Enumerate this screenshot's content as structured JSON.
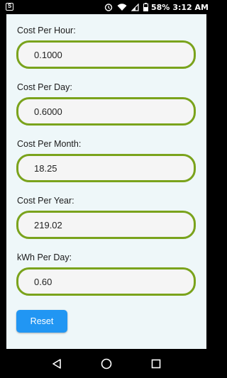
{
  "status_bar": {
    "battery_percent": "58%",
    "time": "3:12 AM"
  },
  "fields": [
    {
      "label": "Cost Per Hour:",
      "value": "0.1000"
    },
    {
      "label": "Cost Per Day:",
      "value": "0.6000"
    },
    {
      "label": "Cost Per Month:",
      "value": "18.25"
    },
    {
      "label": "Cost Per Year:",
      "value": "219.02"
    },
    {
      "label": "kWh Per Day:",
      "value": "0.60"
    }
  ],
  "reset_label": "Reset",
  "colors": {
    "accent_border": "#7aa31c",
    "button": "#2196f3",
    "background": "#eef7f9"
  },
  "icons": {
    "status": [
      "notification-icon",
      "alarm-icon",
      "wifi-icon",
      "signal-icon",
      "battery-icon"
    ],
    "nav": [
      "back-icon",
      "home-icon",
      "recents-icon"
    ]
  }
}
